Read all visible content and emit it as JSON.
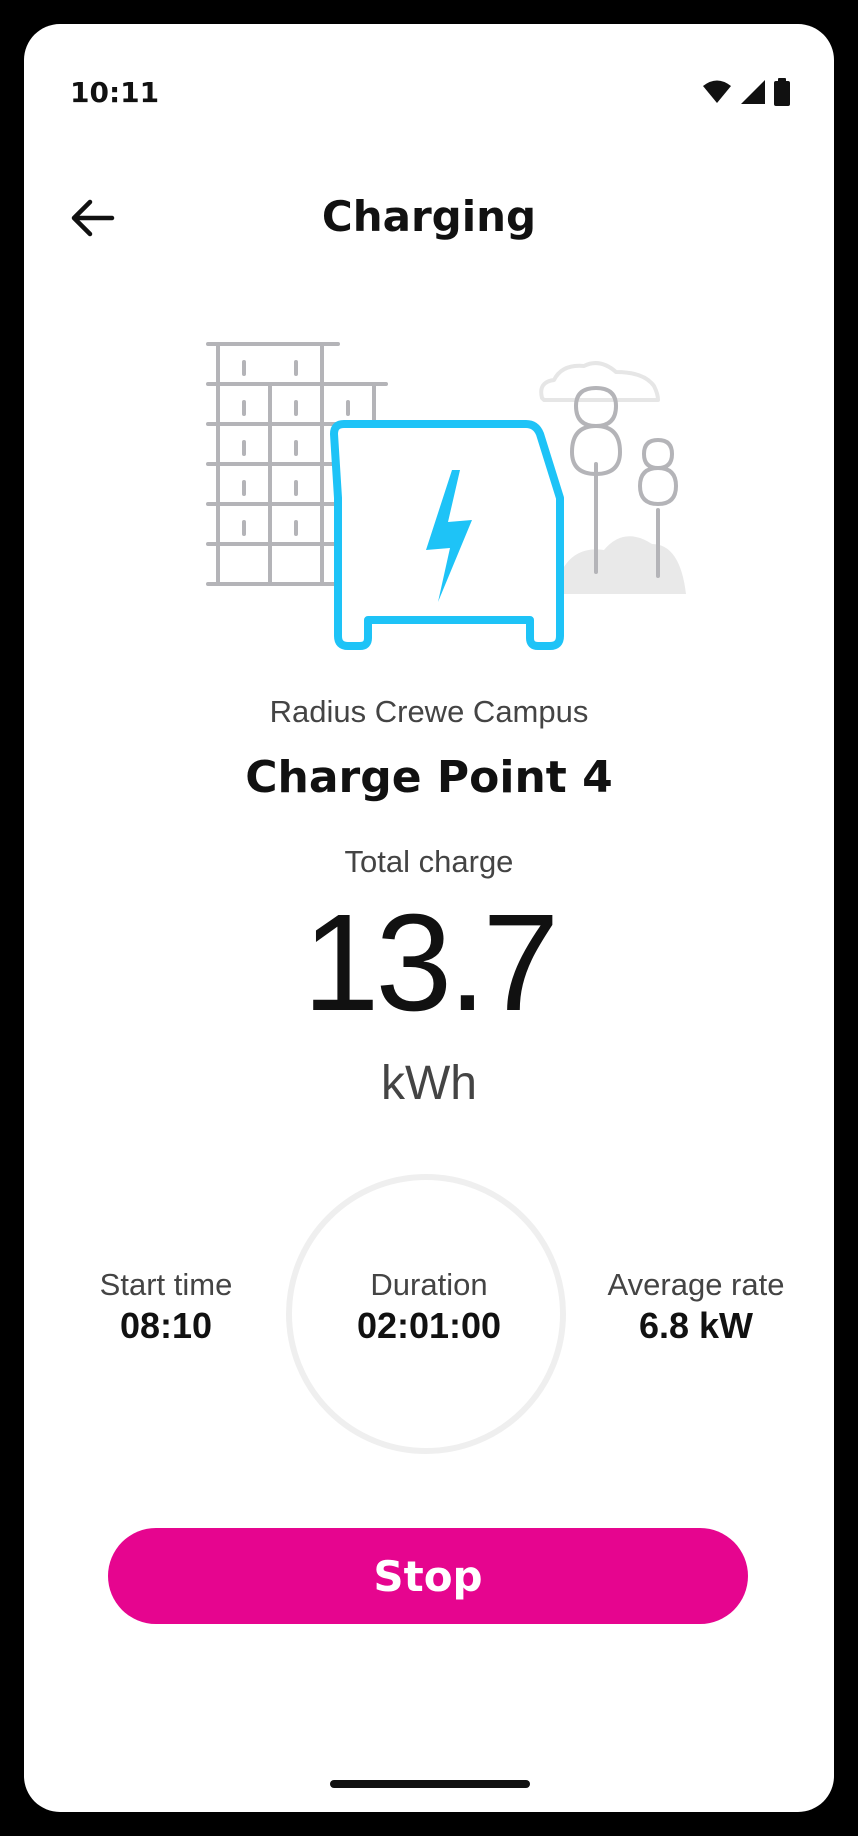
{
  "status_bar": {
    "time": "10:11",
    "icons": [
      "wifi-icon",
      "cellular-signal-icon",
      "battery-icon"
    ]
  },
  "header": {
    "title": "Charging",
    "back_icon": "arrow-left-icon"
  },
  "illustration": {
    "icons": [
      "building-icon",
      "cloud-icon",
      "tree-icon",
      "car-icon",
      "lightning-bolt-icon"
    ]
  },
  "session": {
    "location": "Radius Crewe Campus",
    "charge_point": "Charge Point 4",
    "total_label": "Total charge",
    "total_value": "13.7",
    "total_unit": "kWh"
  },
  "stats": {
    "start_time": {
      "label": "Start time",
      "value": "08:10"
    },
    "duration": {
      "label": "Duration",
      "value": "02:01:00"
    },
    "average_rate": {
      "label": "Average rate",
      "value": "6.8 kW"
    }
  },
  "actions": {
    "stop_label": "Stop"
  },
  "colors": {
    "accent": "#e6058f",
    "car_outline": "#1ec3f7",
    "building_lines": "#b4b4b8",
    "text_primary": "#111111",
    "text_secondary": "#444444",
    "ring": "#efefef"
  }
}
